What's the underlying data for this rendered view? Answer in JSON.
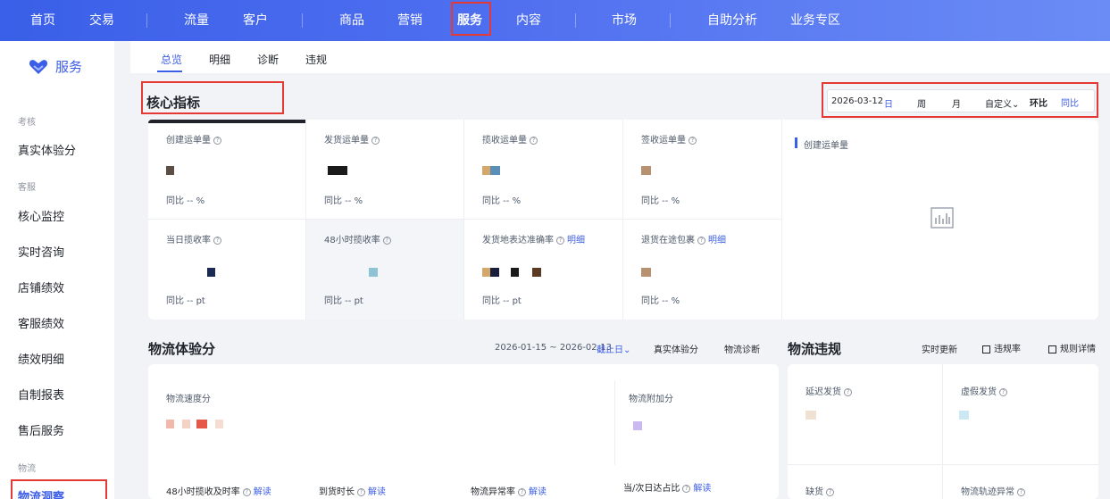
{
  "topnav": {
    "items": [
      "首页",
      "交易",
      "流量",
      "客户",
      "商品",
      "营销",
      "服务",
      "内容",
      "市场",
      "自助分析",
      "业务专区"
    ],
    "active": "服务"
  },
  "sidebar": {
    "title": "服务",
    "groups": [
      {
        "label": "考核",
        "items": [
          "真实体验分"
        ]
      },
      {
        "label": "客服",
        "items": [
          "核心监控",
          "实时咨询",
          "店铺绩效",
          "客服绩效",
          "绩效明细",
          "自制报表",
          "售后服务"
        ]
      },
      {
        "label": "物流",
        "items": [
          "物流洞察"
        ]
      }
    ],
    "active_item": "物流洞察"
  },
  "subtabs": {
    "items": [
      "总览",
      "明细",
      "诊断",
      "违规"
    ],
    "active": "总览"
  },
  "core": {
    "title": "核心指标",
    "date": "2026-03-12",
    "granularity": [
      "日",
      "周",
      "月"
    ],
    "active_granularity": "日",
    "custom": "自定义",
    "compare": [
      "环比",
      "同比"
    ],
    "active_compare": "同比",
    "metrics": [
      {
        "label": "创建运单量",
        "yoy": "同比 -- %"
      },
      {
        "label": "发货运单量",
        "yoy": "同比 -- %"
      },
      {
        "label": "揽收运单量",
        "yoy": "同比 -- %"
      },
      {
        "label": "签收运单量",
        "yoy": "同比 -- %"
      },
      {
        "label": "当日揽收率",
        "yoy": "同比 -- pt"
      },
      {
        "label": "48小时揽收率",
        "yoy": "同比 -- pt"
      },
      {
        "label": "发货地表达准确率",
        "link": "明细",
        "yoy": "同比 -- pt"
      },
      {
        "label": "退货在途包裹",
        "link": "明细",
        "yoy": "同比 -- %"
      }
    ],
    "chart_title": "创建运单量"
  },
  "logistics": {
    "title": "物流体验分",
    "date_range": "2026-01-15 ~ 2026-02-13",
    "deadline": "截止日",
    "links": [
      "真实体验分",
      "物流诊断"
    ],
    "speed_label": "物流速度分",
    "bonus_label": "物流附加分",
    "bottom": [
      {
        "label": "48小时揽收及时率",
        "link": "解读"
      },
      {
        "label": "到货时长",
        "link": "解读"
      },
      {
        "label": "物流异常率",
        "link": "解读"
      },
      {
        "label": "当/次日达占比",
        "link": "解读"
      }
    ]
  },
  "violation": {
    "title": "物流违规",
    "realtime": "实时更新",
    "rate": "违规率",
    "rules": "规则详情",
    "items": [
      {
        "label": "延迟发货"
      },
      {
        "label": "虚假发货"
      },
      {
        "label": "缺货"
      },
      {
        "label": "物流轨迹异常"
      }
    ]
  },
  "colors": {
    "brand": "#3c5de8",
    "highlight": "#e53935"
  }
}
